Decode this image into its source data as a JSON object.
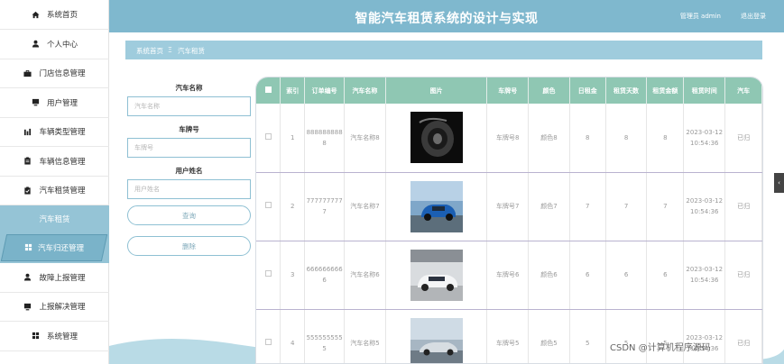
{
  "header": {
    "title": "智能汽车租赁系统的设计与实现",
    "admin_label": "管理员 admin",
    "logout_label": "退出登录"
  },
  "sidebar": {
    "items": [
      {
        "label": "系统首页",
        "icon": "home-icon"
      },
      {
        "label": "个人中心",
        "icon": "user-icon"
      },
      {
        "label": "门店信息管理",
        "icon": "briefcase-icon"
      },
      {
        "label": "用户管理",
        "icon": "monitor-icon"
      },
      {
        "label": "车辆类型管理",
        "icon": "bar-chart-icon"
      },
      {
        "label": "车辆信息管理",
        "icon": "clipboard-icon"
      },
      {
        "label": "汽车租赁管理",
        "icon": "clipboard-check-icon"
      }
    ],
    "submenu_title": "汽车租赁",
    "submenu_active": {
      "label": "汽车归还管理",
      "icon": "grid-icon"
    },
    "items_after": [
      {
        "label": "故障上报管理",
        "icon": "user-icon"
      },
      {
        "label": "上报解决管理",
        "icon": "monitor-icon"
      },
      {
        "label": "系统管理",
        "icon": "grid-icon"
      }
    ]
  },
  "breadcrumb": {
    "home": "系统首页",
    "separator": "Ξ",
    "current": "汽车租赁"
  },
  "search": {
    "car_name_label": "汽车名称",
    "car_name_placeholder": "汽车名称",
    "plate_label": "车牌号",
    "plate_placeholder": "车牌号",
    "user_label": "用户姓名",
    "user_placeholder": "用户姓名",
    "query_button": "查询",
    "delete_button": "删除"
  },
  "table": {
    "columns": [
      "索引",
      "订单编号",
      "汽车名称",
      "图片",
      "车牌号",
      "颜色",
      "日租金",
      "租赁天数",
      "租赁金额",
      "租赁时间",
      "汽车"
    ],
    "rows": [
      {
        "index": "1",
        "order": "8888888888",
        "name": "汽车名称8",
        "image": "car-tire-photo",
        "plate": "车牌号8",
        "color": "颜色8",
        "daily": "8",
        "days": "8",
        "amount": "8",
        "time": "2023-03-12 10:54:36",
        "status": "已归"
      },
      {
        "index": "2",
        "order": "7777777777",
        "name": "汽车名称7",
        "image": "blue-car-photo",
        "plate": "车牌号7",
        "color": "颜色7",
        "daily": "7",
        "days": "7",
        "amount": "7",
        "time": "2023-03-12 10:54:36",
        "status": "已归"
      },
      {
        "index": "3",
        "order": "6666666666",
        "name": "汽车名称6",
        "image": "white-car-photo",
        "plate": "车牌号6",
        "color": "颜色6",
        "daily": "6",
        "days": "6",
        "amount": "6",
        "time": "2023-03-12 10:54:36",
        "status": "已归"
      },
      {
        "index": "4",
        "order": "5555555555",
        "name": "汽车名称5",
        "image": "sports-car-photo",
        "plate": "车牌号5",
        "color": "颜色5",
        "daily": "5",
        "days": "5",
        "amount": "5",
        "time": "2023-03-12 10:54:36",
        "status": "已归"
      }
    ]
  },
  "watermark": "CSDN @计算机程序源码",
  "colors": {
    "header_bg": "#7fb8ce",
    "breadcrumb_bg": "#9fccdd",
    "table_header_bg": "#8fc7b3",
    "sidebar_active_bg": "#7ab3c9"
  }
}
